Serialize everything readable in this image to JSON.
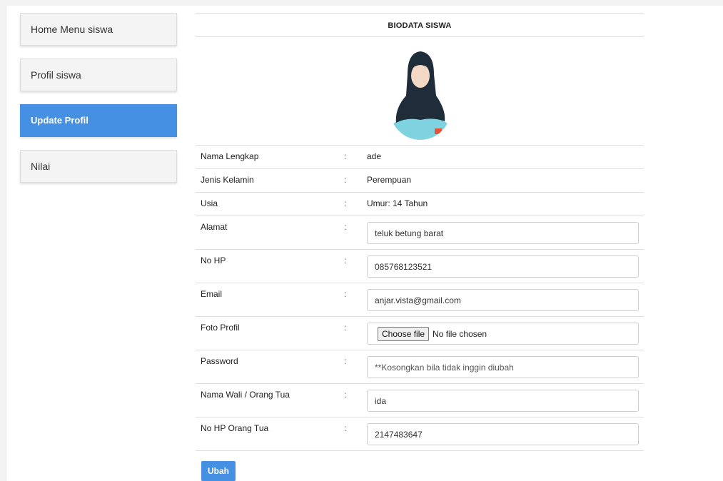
{
  "sidebar": {
    "items": [
      {
        "label": "Home Menu siswa"
      },
      {
        "label": "Profil siswa"
      },
      {
        "label": "Update Profil"
      },
      {
        "label": "Nilai"
      }
    ]
  },
  "content": {
    "title": "BIODATA SISWA",
    "separator": ":",
    "static_rows": [
      {
        "label": "Nama Lengkap",
        "value": "ade"
      },
      {
        "label": "Jenis Kelamin",
        "value": "Perempuan"
      },
      {
        "label": "Usia",
        "value": "Umur: 14 Tahun"
      }
    ],
    "form": {
      "alamat": {
        "label": "Alamat",
        "value": "teluk betung barat"
      },
      "no_hp": {
        "label": "No HP",
        "value": "085768123521"
      },
      "email": {
        "label": "Email",
        "value": "anjar.vista@gmail.com"
      },
      "foto": {
        "label": "Foto Profil",
        "button": "Choose file",
        "status": "No file chosen"
      },
      "password": {
        "label": "Password",
        "placeholder": "**Kosongkan bila tidak inggin diubah"
      },
      "wali": {
        "label": "Nama Wali / Orang Tua",
        "value": "ida"
      },
      "hp_ortu": {
        "label": "No HP Orang Tua",
        "value": "2147483647"
      }
    },
    "submit_label": "Ubah"
  },
  "colors": {
    "accent": "#4590e3",
    "nav_bg": "#f4f4f4"
  }
}
